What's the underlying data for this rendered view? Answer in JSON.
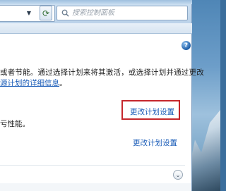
{
  "search": {
    "placeholder": "搜索控制面板"
  },
  "nav": {
    "dropdown_glyph": "▼",
    "forward_glyph": "▸",
    "refresh_glyph": "⟳"
  },
  "help": {
    "label": "?"
  },
  "content": {
    "description_line1": "或者节能。通过选择计划来将其激活，或选择计划并通过更改",
    "description_line2_link": "源计划的详细信息",
    "description_line2_suffix": "。",
    "plan1_link": "更改计划设置",
    "performance_text": "亏性能。",
    "plan2_link": "更改计划设置"
  },
  "colors": {
    "link": "#1a5cb8",
    "highlight_border": "#c5262c"
  }
}
